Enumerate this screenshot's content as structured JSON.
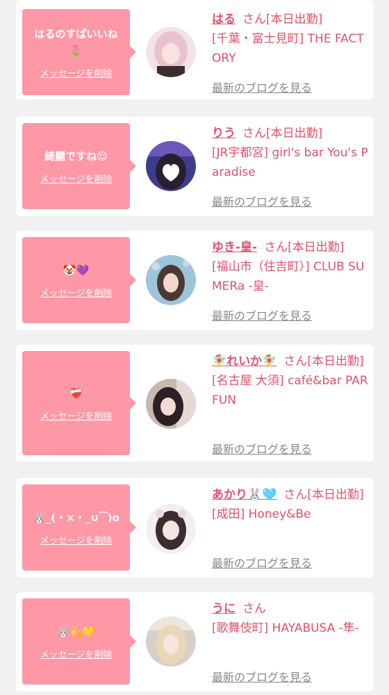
{
  "common": {
    "delete_label": "メッセージを削除",
    "blog_label": "最新のブログを見る"
  },
  "items": [
    {
      "message": "はるのすぱいいね🌷",
      "name": "はる",
      "honorific": "さん",
      "status": "[本日出勤]",
      "shop": "[千葉・富士見町] THE FACTORY",
      "avatar_colors": [
        "#f1e4e8",
        "#e8c2cf",
        "#3a2c2c"
      ]
    },
    {
      "message": "綺麗ですね😌",
      "name": "りう",
      "honorific": "さん",
      "status": "[本日出勤]",
      "shop": "[JR宇都宮] girl's bar You's Paradise",
      "avatar_colors": [
        "#3b3f8a",
        "#6b58b8",
        "#2a1f2e"
      ]
    },
    {
      "message": "🤡💜",
      "name": "ゆき-皇-",
      "honorific": "さん",
      "status": "[本日出勤]",
      "shop": "[福山市（住吉町）] CLUB SUMERa -皇-",
      "avatar_colors": [
        "#9ec4dc",
        "#c9dbe6",
        "#4a3a32"
      ]
    },
    {
      "message": "❤️‍🩹",
      "name": "🧚‍♀️れいか🧚‍♀️",
      "honorific": "さん",
      "status": "[本日出勤]",
      "shop": "[名古屋 大須] café&bar PARFUN",
      "avatar_colors": [
        "#c9b8b0",
        "#e6d9d4",
        "#2b2124"
      ]
    },
    {
      "message": "🐰_(・×・_∪⁀)o",
      "name": "あかり🐰🩵",
      "honorific": "さん",
      "status": "[本日出勤]",
      "shop": "[成田] Honey&Be",
      "avatar_colors": [
        "#f4eef0",
        "#ead9dd",
        "#3b2e30"
      ]
    },
    {
      "message": "🐰💫💛",
      "name": "うに",
      "honorific": "さん",
      "status": "",
      "shop": "[歌舞伎町] HAYABUSA -隼-",
      "avatar_colors": [
        "#d8d0c8",
        "#eee6dc",
        "#e9d7b8"
      ]
    }
  ]
}
